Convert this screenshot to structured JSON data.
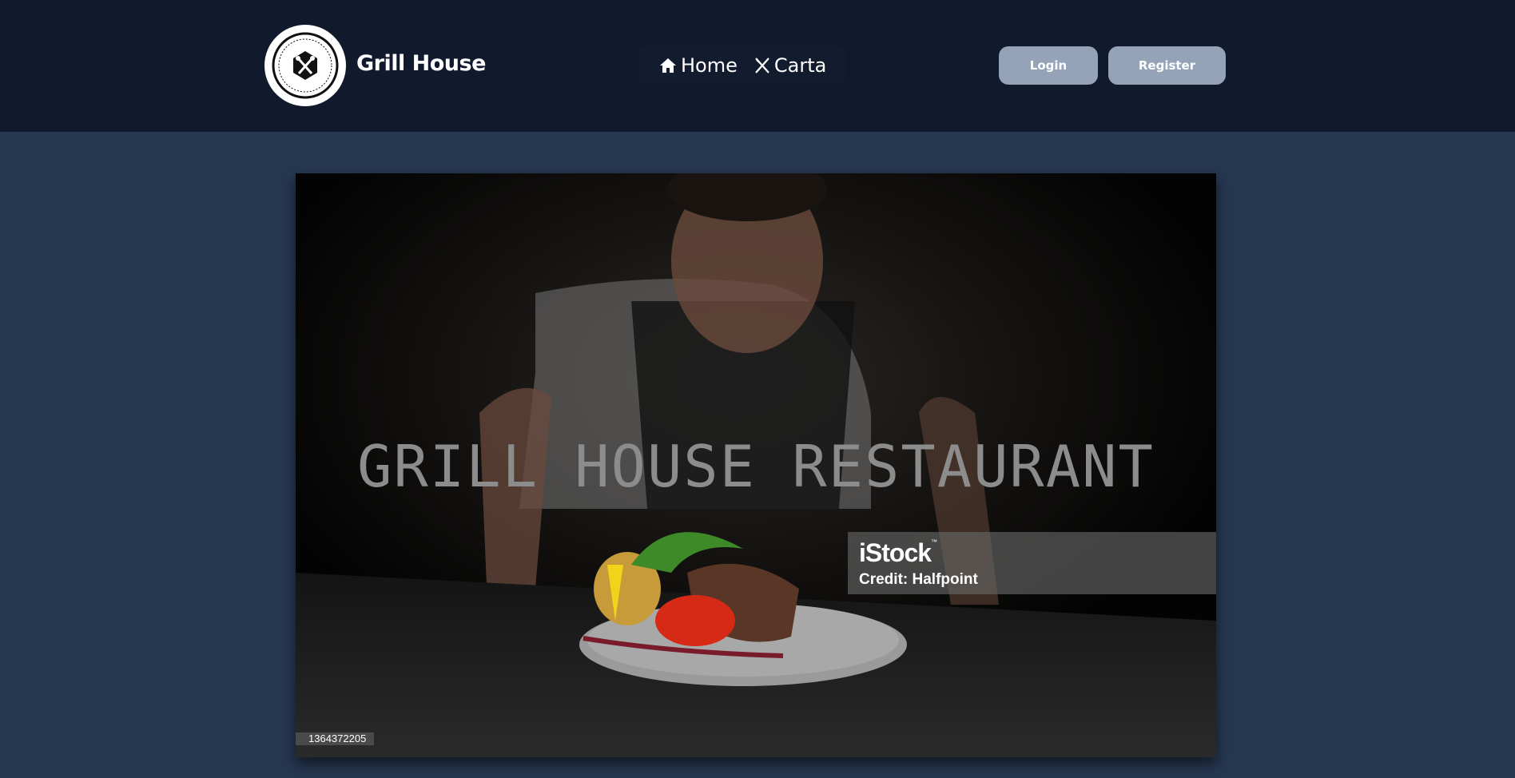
{
  "header": {
    "brand": "Grill House",
    "logo_icon": "grill-house-logo",
    "nav": [
      {
        "label": "Home",
        "icon": "home-icon"
      },
      {
        "label": "Carta",
        "icon": "utensils-icon"
      }
    ],
    "login_label": "Login",
    "register_label": "Register"
  },
  "hero": {
    "title": "GRILL HOUSE RESTAURANT",
    "stock_brand": "iStock",
    "stock_tm": "™",
    "credit": "Credit: Halfpoint",
    "image_id": "1364372205"
  },
  "colors": {
    "header_bg": "#111a2c",
    "page_bg": "#263750",
    "button_bg": "#94a3b8"
  }
}
